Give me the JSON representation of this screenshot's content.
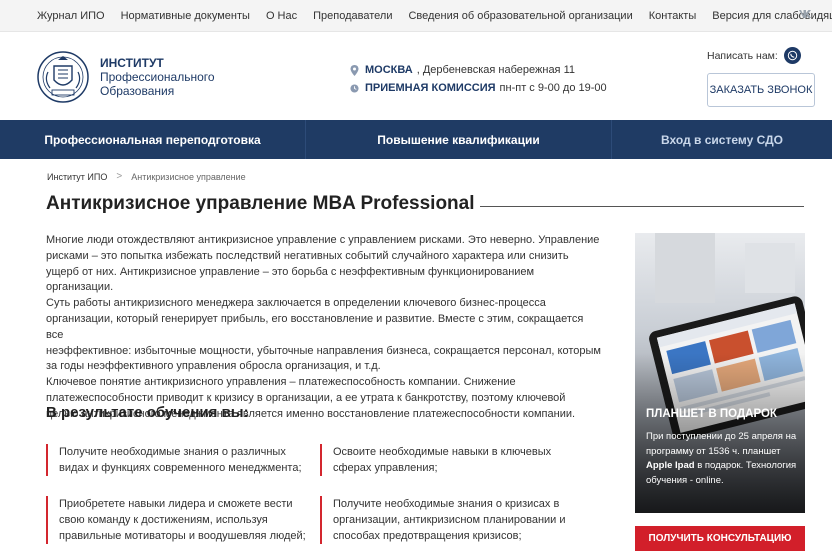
{
  "topnav": {
    "items": [
      "Журнал ИПО",
      "Нормативные документы",
      "О Нас",
      "Преподаватели",
      "Сведения об образовательной организации",
      "Контакты",
      "Версия для слабовидящих"
    ],
    "social_icon": "vk-icon"
  },
  "header": {
    "brand_line1": "ИНСТИТУТ",
    "brand_line2": "Профессионального",
    "brand_line3": "Образования",
    "city": "МОСКВА",
    "address": ", Дербеневская набережная 11",
    "admission_label": "ПРИЕМНАЯ КОМИССИЯ",
    "admission_hours": " пн-пт с 9-00 до 19-00",
    "write_label": "Написать нам:",
    "call_button": "ЗАКАЗАТЬ ЗВОНОК"
  },
  "mainnav": {
    "items": [
      "Профессиональная переподготовка",
      "Повышение квалификации",
      "Вход в систему СДО"
    ]
  },
  "breadcrumb": {
    "home": "Институт ИПО",
    "separator": ">",
    "current": "Антикризисное управление"
  },
  "page": {
    "title": "Антикризисное управление MBA Professional",
    "lines": [
      "Многие люди отождествляют антикризисное управление с управлением рисками. Это неверно. Управление",
      "рисками – это попытка избежать последствий негативных событий случайного характера или снизить",
      "ущерб от них. Антикризисное управление – это борьба с неэффективным функционированием организации.",
      "Суть работы антикризисного менеджера заключается в определении ключевого бизнес-процесса",
      "организации, который генерирует прибыль, его восстановление и развитие. Вместе с этим, сокращается все",
      "неэффективное: избыточные мощности, убыточные направления бизнеса, сокращается персонал, которым",
      "за годы неэффективного управления обросла организация, и т.д.",
      "Ключевое понятие антикризисного управления – платежеспособность компании. Снижение",
      "платежеспособности приводит к кризису в организации, а ее утрата к банкротству, поэтому ключевой",
      "целью антикризисного менеджмента является именно восстановление платежеспособности компании."
    ],
    "results_heading": "В результате обучения вы:",
    "points": [
      [
        "Получите необходимые знания о различных",
        "видах и функциях современного менеджмента;"
      ],
      [
        "Освоите необходимые навыки в ключевых",
        "сферах управления;"
      ],
      [
        "Приобретете навыки лидера и сможете вести",
        "свою команду к достижениям, используя",
        "правильные мотиваторы и воодушевляя людей;"
      ],
      [
        "Получите необходимые знания о кризисах в",
        "организации, антикризисном планировании и",
        "способах предотвращения кризисов;"
      ]
    ]
  },
  "promo": {
    "title": "ПЛАНШЕТ В ПОДАРОК",
    "text_lines": [
      "При поступлении до 25 апреля на",
      "программу от 1536 ч. планшет",
      "Apple Ipad в подарок. Технология",
      "обучения - online."
    ],
    "bold_part": "Apple Ipad",
    "consult_button": "ПОЛУЧИТЬ КОНСУЛЬТАЦИЮ"
  },
  "colors": {
    "navy": "#1f3b64",
    "accent_red": "#d21f2a",
    "topbar_bg": "#f4f4f4"
  }
}
